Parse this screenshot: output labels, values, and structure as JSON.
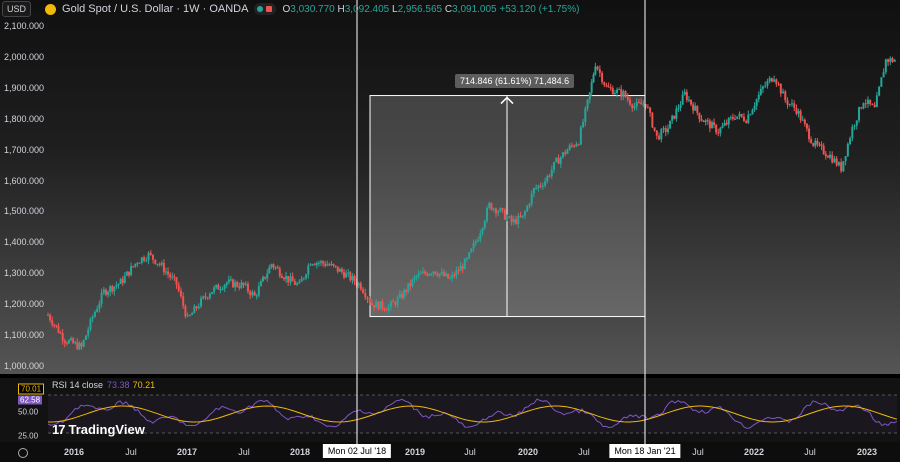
{
  "header": {
    "currency": "USD",
    "title": "Gold Spot / U.S. Dollar · 1W · OANDA",
    "ohlc": {
      "o_label": "O",
      "o": "3,030.770",
      "h_label": "H",
      "h": "3,092.405",
      "l_label": "L",
      "l": "2,956.565",
      "c_label": "C",
      "c": "3,091.005",
      "change": "+53.120 (+1.75%)"
    },
    "colors": {
      "up": "#26a69a",
      "down": "#ef5350",
      "brand": "#f0b90b"
    }
  },
  "price_axis": {
    "labels": [
      "2,100.000",
      "2,000.000",
      "1,900.000",
      "1,800.000",
      "1,700.000",
      "1,600.000",
      "1,500.000",
      "1,400.000",
      "1,300.000",
      "1,200.000",
      "1,100.000",
      "1,000.000"
    ],
    "values": [
      2100,
      2000,
      1900,
      1800,
      1700,
      1600,
      1500,
      1400,
      1300,
      1200,
      1100,
      1000
    ]
  },
  "measure": {
    "tooltip": "714.846 (61.61%) 71,484.6",
    "low": 1160,
    "high": 1875
  },
  "crosshairs": {
    "left_label": "Mon 02 Jul '18",
    "right_label": "Mon 18 Jan '21"
  },
  "rsi": {
    "legend": "RSI 14 close",
    "value1": "73.38",
    "value2": "70.21",
    "badge_upper": "70.01",
    "badge_mid": "62.58",
    "scale": [
      "50.00",
      "25.00"
    ]
  },
  "brand": {
    "name": "TradingView",
    "mark": "17"
  },
  "time_axis": {
    "ticks": [
      {
        "label": "2016",
        "bold": true
      },
      {
        "label": "Jul",
        "bold": false
      },
      {
        "label": "2017",
        "bold": true
      },
      {
        "label": "Jul",
        "bold": false
      },
      {
        "label": "2018",
        "bold": true
      },
      {
        "label": "2019",
        "bold": true
      },
      {
        "label": "Jul",
        "bold": false
      },
      {
        "label": "2020",
        "bold": true
      },
      {
        "label": "Jul",
        "bold": false
      },
      {
        "label": "Jul",
        "bold": false
      },
      {
        "label": "2022",
        "bold": true
      },
      {
        "label": "Jul",
        "bold": false
      },
      {
        "label": "2023",
        "bold": true
      }
    ]
  },
  "chart_data": {
    "type": "candlestick",
    "title": "Gold Spot / U.S. Dollar · 1W · OANDA",
    "x_range": [
      "2015-09",
      "2023-05"
    ],
    "ylim": [
      1000,
      2100
    ],
    "series": [
      {
        "values": [
          [
            2015.7,
            1165
          ],
          [
            2015.85,
            1085
          ],
          [
            2016.0,
            1060
          ],
          [
            2016.1,
            1160
          ],
          [
            2016.2,
            1240
          ],
          [
            2016.35,
            1270
          ],
          [
            2016.5,
            1340
          ],
          [
            2016.6,
            1360
          ],
          [
            2016.7,
            1330
          ],
          [
            2016.85,
            1265
          ],
          [
            2016.95,
            1150
          ],
          [
            2017.05,
            1200
          ],
          [
            2017.15,
            1240
          ],
          [
            2017.3,
            1270
          ],
          [
            2017.45,
            1260
          ],
          [
            2017.55,
            1225
          ],
          [
            2017.7,
            1330
          ],
          [
            2017.85,
            1280
          ],
          [
            2017.95,
            1260
          ],
          [
            2018.05,
            1340
          ],
          [
            2018.2,
            1330
          ],
          [
            2018.35,
            1300
          ],
          [
            2018.5,
            1260
          ],
          [
            2018.6,
            1200
          ],
          [
            2018.75,
            1190
          ],
          [
            2018.85,
            1220
          ],
          [
            2019.0,
            1290
          ],
          [
            2019.15,
            1310
          ],
          [
            2019.3,
            1280
          ],
          [
            2019.45,
            1340
          ],
          [
            2019.55,
            1420
          ],
          [
            2019.65,
            1520
          ],
          [
            2019.75,
            1500
          ],
          [
            2019.85,
            1465
          ],
          [
            2019.95,
            1480
          ],
          [
            2020.05,
            1570
          ],
          [
            2020.15,
            1600
          ],
          [
            2020.25,
            1660
          ],
          [
            2020.35,
            1700
          ],
          [
            2020.45,
            1730
          ],
          [
            2020.55,
            1880
          ],
          [
            2020.6,
            1980
          ],
          [
            2020.7,
            1900
          ],
          [
            2020.85,
            1880
          ],
          [
            2020.95,
            1840
          ],
          [
            2021.05,
            1850
          ],
          [
            2021.15,
            1740
          ],
          [
            2021.25,
            1770
          ],
          [
            2021.4,
            1880
          ],
          [
            2021.55,
            1800
          ],
          [
            2021.7,
            1760
          ],
          [
            2021.85,
            1810
          ],
          [
            2021.95,
            1800
          ],
          [
            2022.1,
            1900
          ],
          [
            2022.2,
            1940
          ],
          [
            2022.3,
            1860
          ],
          [
            2022.4,
            1830
          ],
          [
            2022.55,
            1720
          ],
          [
            2022.7,
            1680
          ],
          [
            2022.8,
            1640
          ],
          [
            2022.9,
            1770
          ],
          [
            2023.0,
            1860
          ],
          [
            2023.1,
            1830
          ],
          [
            2023.2,
            1990
          ],
          [
            2023.3,
            1990
          ]
        ]
      }
    ]
  }
}
